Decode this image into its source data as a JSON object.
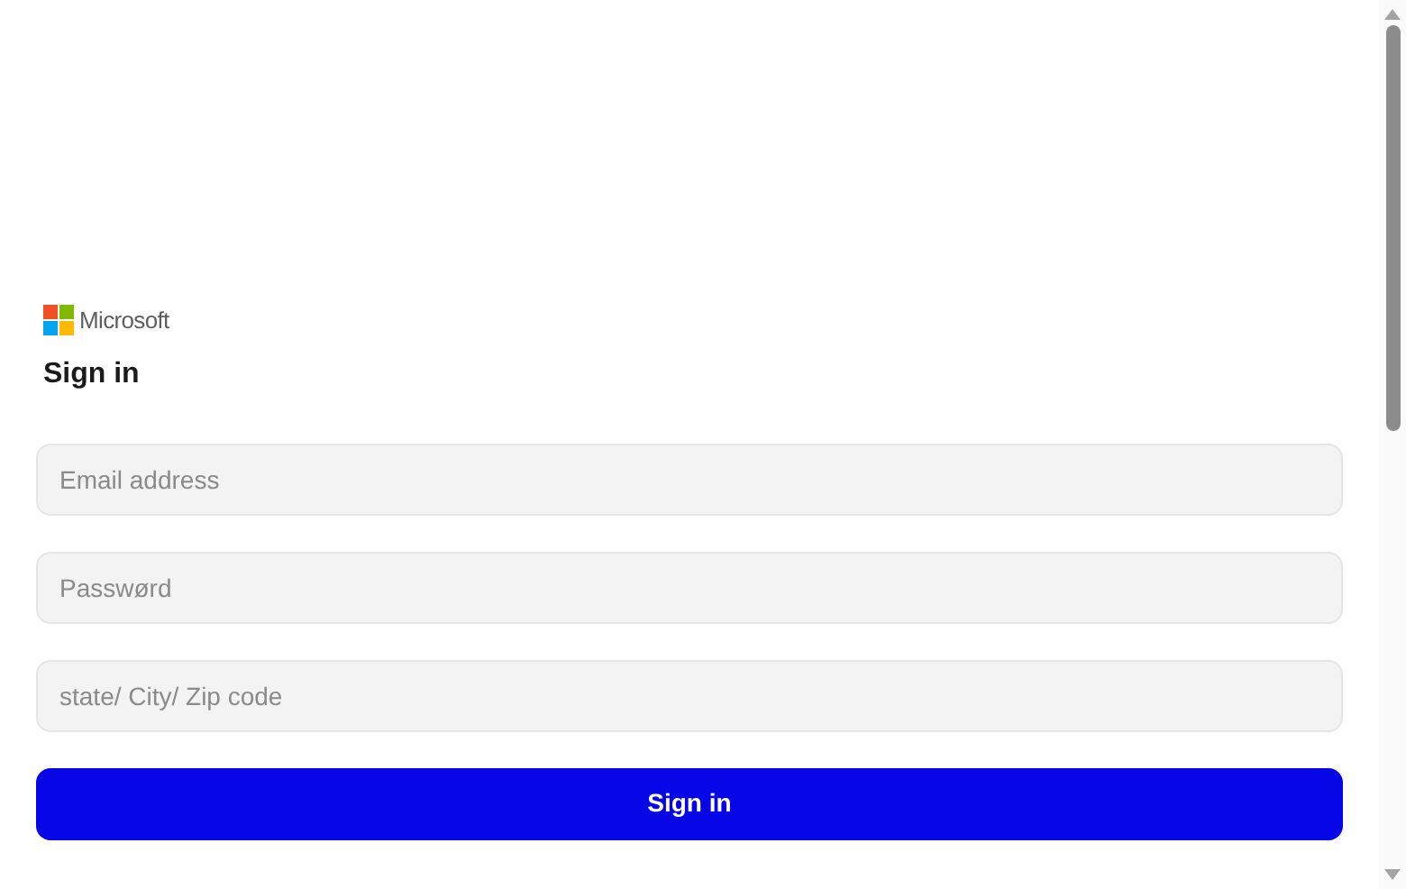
{
  "logo": {
    "text": "Microsoft"
  },
  "heading": "Sign in",
  "fields": [
    {
      "placeholder": "Email address"
    },
    {
      "placeholder": "Passwørd"
    },
    {
      "placeholder": "state/ City/ Zip code"
    }
  ],
  "submit_button": "Sign in"
}
